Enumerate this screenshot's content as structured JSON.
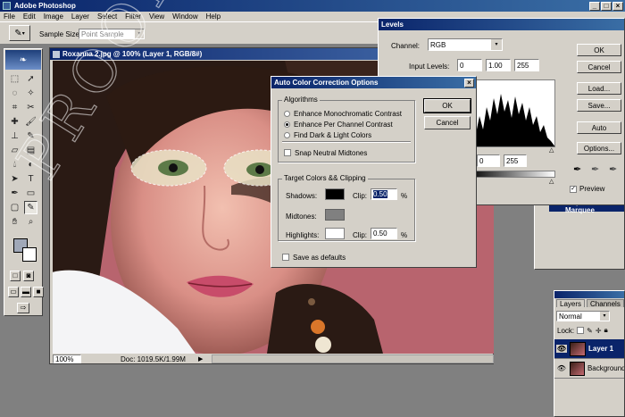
{
  "app": {
    "title": "Adobe Photoshop",
    "window_controls": [
      "_",
      "□",
      "×"
    ]
  },
  "menu": [
    "File",
    "Edit",
    "Image",
    "Layer",
    "Select",
    "Filter",
    "View",
    "Window",
    "Help"
  ],
  "options_bar": {
    "sample_size_label": "Sample Size:",
    "sample_size_value": "Point Sample"
  },
  "document": {
    "title": "Roxanna 2.jpg @ 100% (Layer 1, RGB/8#)",
    "zoom": "100%",
    "doc_size": "Doc: 1019.5K/1.99M"
  },
  "levels": {
    "title": "Levels",
    "channel_label": "Channel:",
    "channel_value": "RGB",
    "input_levels_label": "Input Levels:",
    "input_black": "0",
    "input_gamma": "1.00",
    "input_white": "255",
    "output_black": "0",
    "output_white": "255",
    "buttons": {
      "ok": "OK",
      "cancel": "Cancel",
      "load": "Load...",
      "save": "Save...",
      "auto": "Auto",
      "options": "Options..."
    },
    "preview_label": "Preview",
    "preview_checked": true
  },
  "acc": {
    "title": "Auto Color Correction Options",
    "algorithms_label": "Algorithms",
    "algorithms": [
      {
        "label": "Enhance Monochromatic Contrast",
        "selected": false
      },
      {
        "label": "Enhance Per Channel Contrast",
        "selected": true
      },
      {
        "label": "Find Dark & Light Colors",
        "selected": false
      }
    ],
    "snap_label": "Snap Neutral Midtones",
    "target_label": "Target Colors && Clipping",
    "shadows_label": "Shadows:",
    "midtones_label": "Midtones:",
    "highlights_label": "Highlights:",
    "clip_label": "Clip:",
    "shadows_clip": "0.50",
    "highlights_clip": "0.50",
    "percent": "%",
    "save_defaults_label": "Save as defaults",
    "ok": "OK",
    "cancel": "Cancel",
    "colors": {
      "shadows": "#000000",
      "midtones": "#808080",
      "highlights": "#ffffff"
    }
  },
  "history": {
    "item": "Elliptical Marquee"
  },
  "layers": {
    "tabs": [
      "Layers",
      "Channels"
    ],
    "blend_mode": "Normal",
    "lock_label": "Lock:",
    "items": [
      {
        "name": "Layer 1",
        "selected": true
      },
      {
        "name": "Background",
        "selected": false
      }
    ]
  },
  "watermark": "PROOF"
}
